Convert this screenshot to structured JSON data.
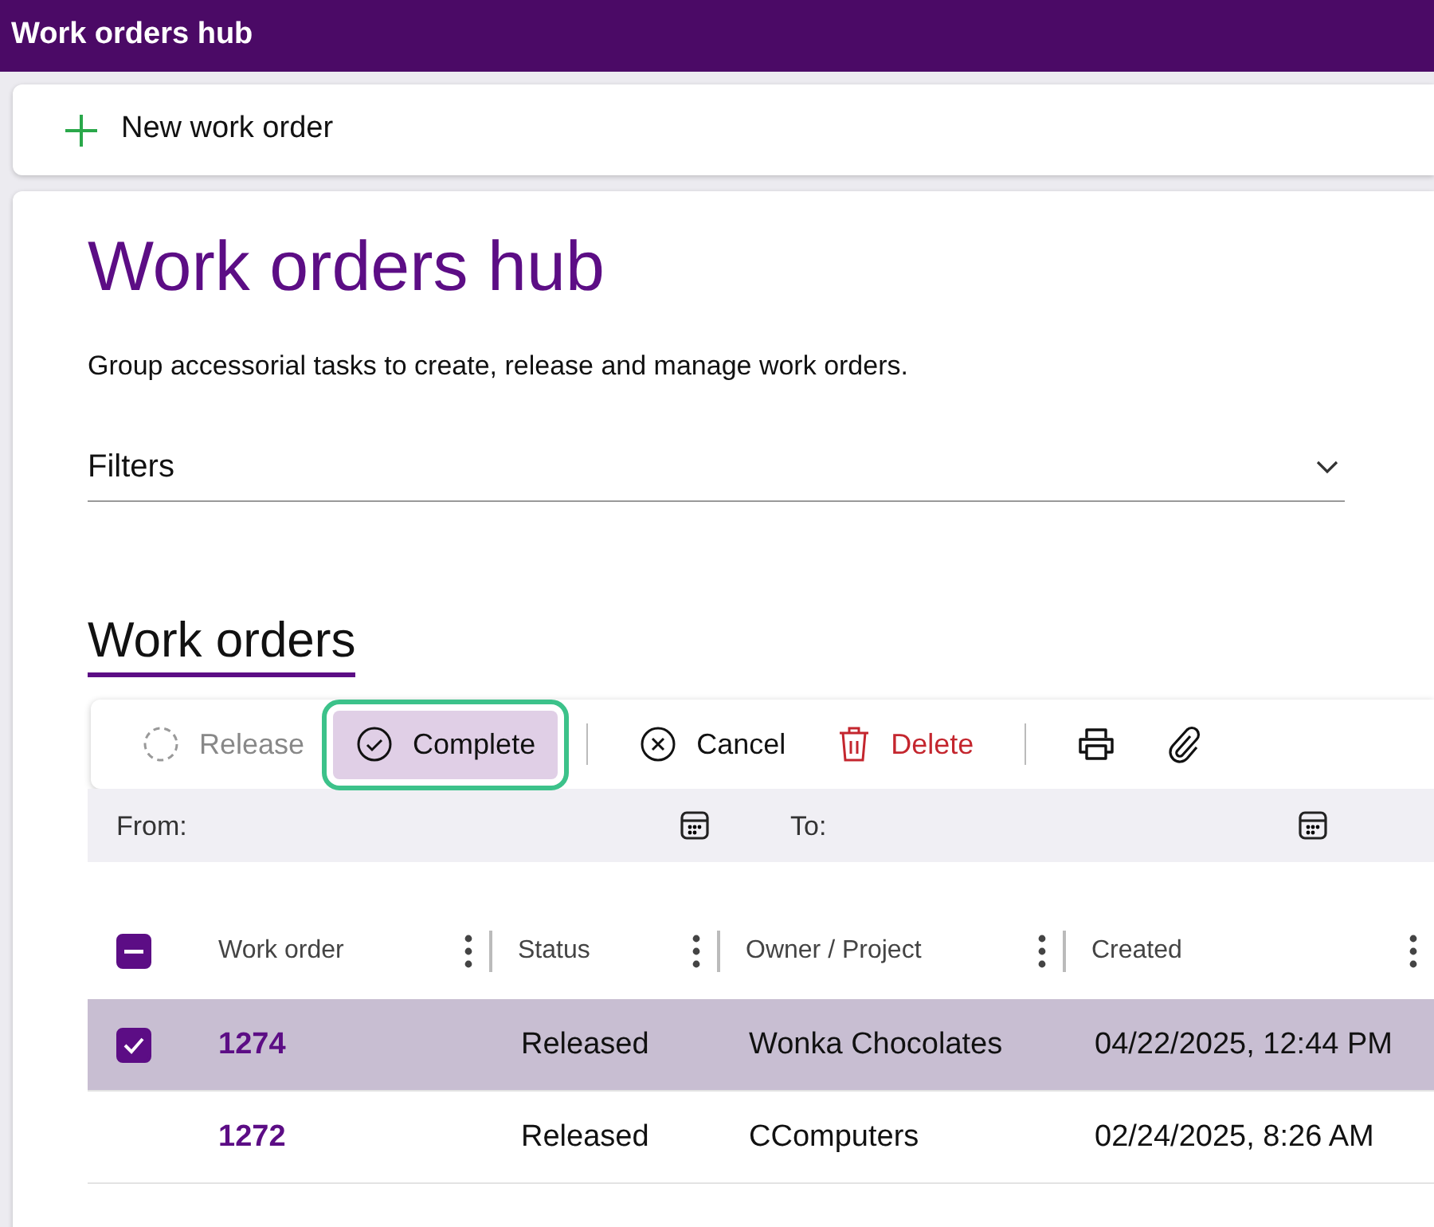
{
  "app_bar": {
    "title": "Work orders hub"
  },
  "action_bar": {
    "new_button": "New work order"
  },
  "page": {
    "title": "Work orders hub",
    "description": "Group accessorial tasks to create, release and manage work orders.",
    "filters": {
      "label": "Filters",
      "expanded": false
    }
  },
  "section": {
    "title": "Work orders",
    "selected": true
  },
  "toolbar": [
    {
      "kind": "release",
      "label": "Release",
      "disabled": true,
      "highlighted": false
    },
    {
      "kind": "complete",
      "label": "Complete",
      "disabled": false,
      "highlighted": true
    },
    {
      "kind": "separator"
    },
    {
      "kind": "cancel",
      "label": "Cancel",
      "disabled": false,
      "highlighted": false
    },
    {
      "kind": "delete",
      "label": "Delete",
      "disabled": false,
      "highlighted": false
    },
    {
      "kind": "separator"
    },
    {
      "kind": "print",
      "disabled": false,
      "highlighted": false
    },
    {
      "kind": "attach",
      "disabled": false,
      "highlighted": false
    }
  ],
  "date_filter": {
    "from_label": "From:",
    "to_label": "To:"
  },
  "table": {
    "select_all": {
      "indeterminate": true
    },
    "columns": [
      "Work order",
      "Status",
      "Owner / Project",
      "Created"
    ],
    "rows": [
      {
        "selected": true,
        "cells": [
          "1274",
          "Released",
          "Wonka Chocolates",
          "04/22/2025, 12:44 PM"
        ]
      },
      {
        "selected": false,
        "cells": [
          "1272",
          "Released",
          "CComputers",
          "02/24/2025, 8:26 AM"
        ]
      }
    ]
  }
}
